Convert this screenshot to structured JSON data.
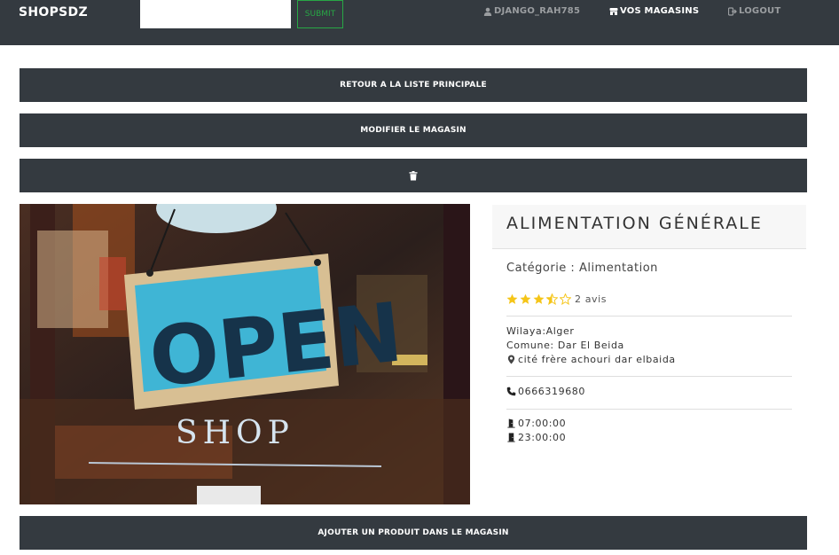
{
  "nav": {
    "brand": "SHOPSDZ",
    "search": {
      "value": "",
      "placeholder": ""
    },
    "submit_label": "SUBMIT",
    "user_label": "DJANGO_RAH785",
    "stores_label": "VOS MAGASINS",
    "logout_label": "LOGOUT"
  },
  "actions": {
    "back_label": "RETOUR A LA LISTE PRINCIPALE",
    "edit_label": "MODIFIER LE MAGASIN",
    "add_product_label": "AJOUTER UN PRODUIT DANS LE MAGASIN"
  },
  "photo": {
    "sign_text": "OPEN",
    "sub_text": "SHOP"
  },
  "store": {
    "name": "ALIMENTATION GÉNÉRALE",
    "category": "Catégorie : Alimentation",
    "rating": 3.5,
    "reviews": "2 avis",
    "wilaya": "Wilaya:Alger",
    "commune": "Comune: Dar El Beida",
    "address": "cité frère achouri dar elbaida",
    "phone": "0666319680",
    "open_time": "07:00:00",
    "close_time": "23:00:00"
  },
  "colors": {
    "navbar": "#343a40",
    "submit": "#28a745",
    "star": "#f5c518"
  },
  "icons": [
    "user-icon",
    "store-icon",
    "logout-icon",
    "trash-icon",
    "star-icon",
    "map-marker-icon",
    "phone-icon",
    "door-open-icon",
    "door-closed-icon"
  ]
}
